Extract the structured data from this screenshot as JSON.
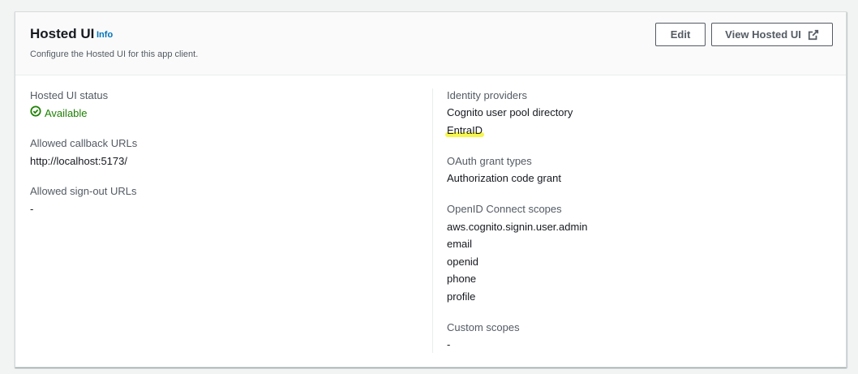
{
  "header": {
    "title": "Hosted UI",
    "info_label": "Info",
    "description": "Configure the Hosted UI for this app client.",
    "edit_label": "Edit",
    "view_label": "View Hosted UI"
  },
  "left": {
    "status_label": "Hosted UI status",
    "status_value": "Available",
    "callback_label": "Allowed callback URLs",
    "callback_value": "http://localhost:5173/",
    "signout_label": "Allowed sign-out URLs",
    "signout_value": "-"
  },
  "right": {
    "idp_label": "Identity providers",
    "idp_values": [
      "Cognito user pool directory",
      "EntraID"
    ],
    "grant_label": "OAuth grant types",
    "grant_value": "Authorization code grant",
    "scopes_label": "OpenID Connect scopes",
    "scopes": [
      "aws.cognito.signin.user.admin",
      "email",
      "openid",
      "phone",
      "profile"
    ],
    "custom_label": "Custom scopes",
    "custom_value": "-"
  },
  "colors": {
    "success": "#1d8102",
    "link": "#0073bb",
    "highlight": "#f5f53a"
  }
}
